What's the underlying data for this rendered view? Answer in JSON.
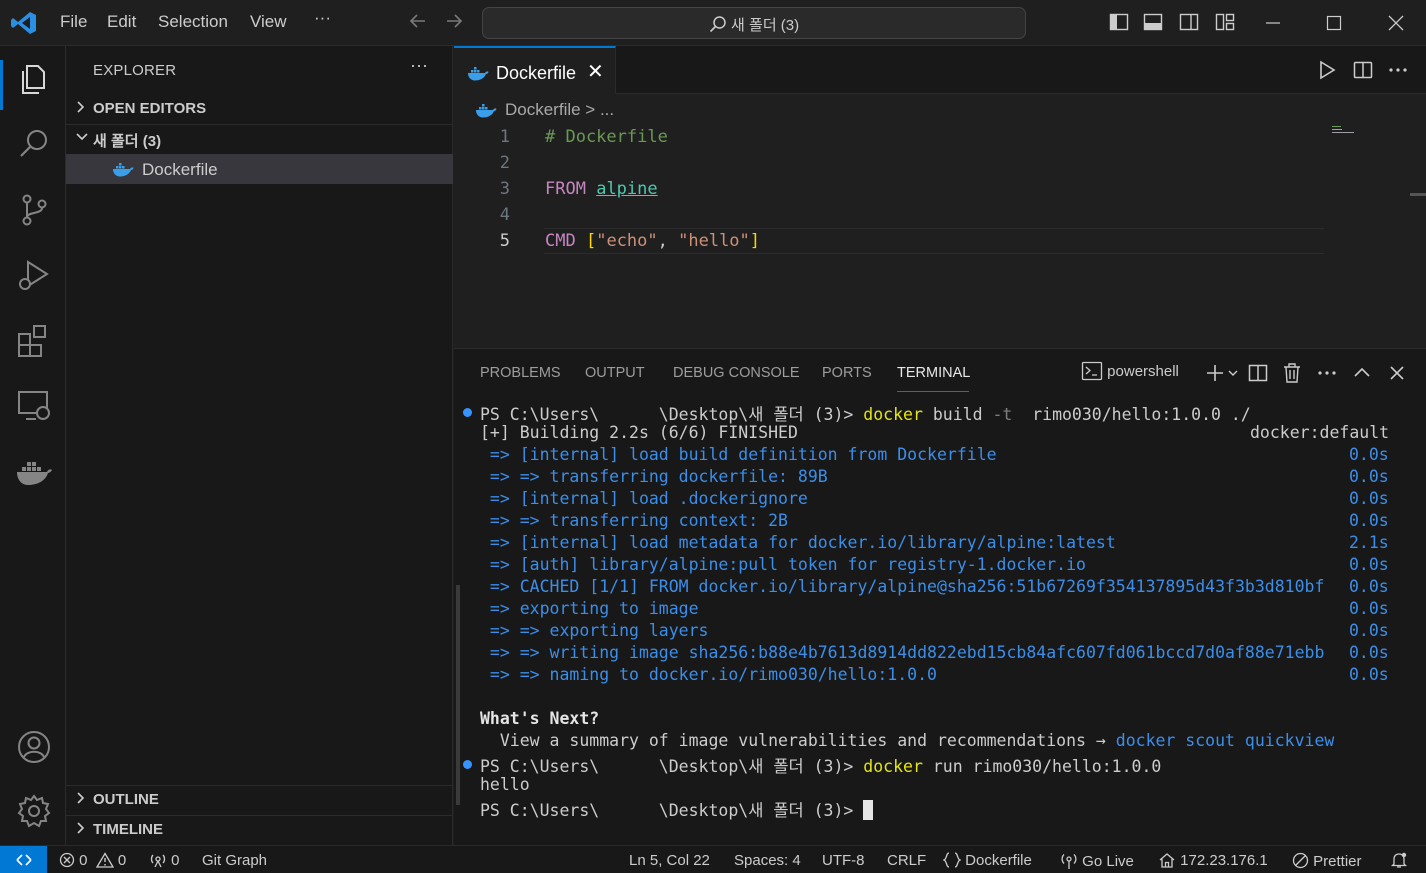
{
  "titlebar": {
    "menu": [
      "File",
      "Edit",
      "Selection",
      "View"
    ],
    "more": "···",
    "search": "새 폴더 (3)",
    "back_icon": "arrow-left-icon",
    "forward_icon": "arrow-right-icon"
  },
  "sidebar": {
    "title": "EXPLORER",
    "more": "···",
    "open_editors": "OPEN EDITORS",
    "folder": "새 폴더 (3)",
    "file": "Dockerfile",
    "outline": "OUTLINE",
    "timeline": "TIMELINE"
  },
  "editor": {
    "tab_label": "Dockerfile",
    "close": "✕",
    "breadcrumb": "Dockerfile > ...",
    "lines": [
      {
        "num": "1"
      },
      {
        "num": "2"
      },
      {
        "num": "3"
      },
      {
        "num": "4"
      },
      {
        "num": "5"
      }
    ],
    "code": {
      "l1": "# Dockerfile",
      "l3_kw": "FROM",
      "l3_img": "alpine",
      "l5_kw": "CMD",
      "l5_open": "[",
      "l5_s1": "\"echo\"",
      "l5_comma": ", ",
      "l5_s2": "\"hello\"",
      "l5_close": "]"
    }
  },
  "panel": {
    "tabs": [
      "PROBLEMS",
      "OUTPUT",
      "DEBUG CONSOLE",
      "PORTS",
      "TERMINAL"
    ],
    "shell": "powershell",
    "terminal": {
      "p1_prompt": "PS C:\\Users\\      \\Desktop\\새 폴더 (3)> ",
      "p1_cmd": "docker",
      "p1_args1": " build ",
      "p1_flag": "-t",
      "p1_args2": "  rimo030/hello:1.0.0 ./",
      "build_line": "[+] Building 2.2s (6/6) FINISHED",
      "build_right": "docker:default",
      "steps": [
        {
          "text": " => [internal] load build definition from Dockerfile",
          "time": "0.0s"
        },
        {
          "text": " => => transferring dockerfile: 89B",
          "time": "0.0s"
        },
        {
          "text": " => [internal] load .dockerignore",
          "time": "0.0s"
        },
        {
          "text": " => => transferring context: 2B",
          "time": "0.0s"
        },
        {
          "text": " => [internal] load metadata for docker.io/library/alpine:latest",
          "time": "2.1s"
        },
        {
          "text": " => [auth] library/alpine:pull token for registry-1.docker.io",
          "time": "0.0s"
        },
        {
          "text": " => CACHED [1/1] FROM docker.io/library/alpine@sha256:51b67269f354137895d43f3b3d810bf",
          "time": "0.0s"
        },
        {
          "text": " => exporting to image",
          "time": "0.0s"
        },
        {
          "text": " => => exporting layers",
          "time": "0.0s"
        },
        {
          "text": " => => writing image sha256:b88e4b7613d8914dd822ebd15cb84afc607fd061bccd7d0af88e71ebb",
          "time": "0.0s"
        },
        {
          "text": " => => naming to docker.io/rimo030/hello:1.0.0",
          "time": "0.0s"
        }
      ],
      "whats_next": "What's Next?",
      "summary": "  View a summary of image vulnerabilities and recommendations → ",
      "scout": "docker scout quickview",
      "p2_prompt": "PS C:\\Users\\      \\Desktop\\새 폴더 (3)> ",
      "p2_cmd": "docker",
      "p2_args": " run rimo030/hello:1.0.0",
      "output": "hello",
      "p3_prompt": "PS C:\\Users\\      \\Desktop\\새 폴더 (3)> "
    }
  },
  "statusbar": {
    "errors": "0",
    "warnings": "0",
    "ports": "0",
    "git_graph": "Git Graph",
    "position": "Ln 5, Col 22",
    "spaces": "Spaces: 4",
    "encoding": "UTF-8",
    "eol": "CRLF",
    "language": "Dockerfile",
    "go_live": "Go Live",
    "ip": "172.23.176.1",
    "prettier": "Prettier"
  },
  "colors": {
    "accent": "#0078d4",
    "docker_blue": "#3b9ee8",
    "terminal_blue": "#3b8eea",
    "terminal_yellow": "#e5e510"
  }
}
